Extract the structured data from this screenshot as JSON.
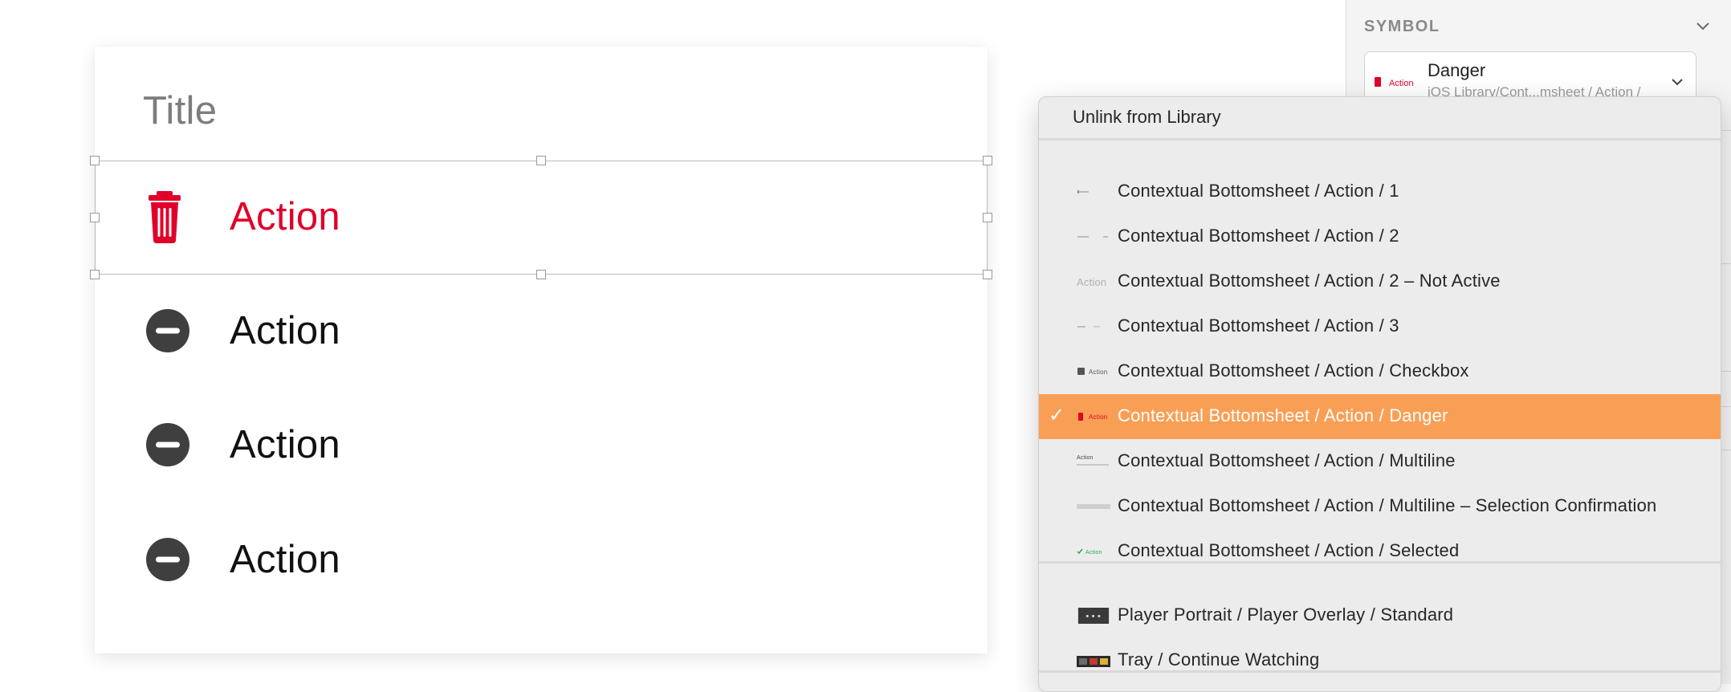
{
  "canvas": {
    "title": "Title",
    "rows": [
      {
        "label": "Action",
        "icon": "trash-icon",
        "variant": "danger"
      },
      {
        "label": "Action",
        "icon": "minus-circle-icon",
        "variant": "normal"
      },
      {
        "label": "Action",
        "icon": "minus-circle-icon",
        "variant": "normal"
      },
      {
        "label": "Action",
        "icon": "minus-circle-icon",
        "variant": "normal"
      }
    ]
  },
  "inspector": {
    "section_title": "SYMBOL",
    "symbol": {
      "name": "Danger",
      "path": "iOS Library/Cont...msheet / Action /",
      "thumb_label": "Action"
    }
  },
  "menu": {
    "unlink_label": "Unlink from Library",
    "group1": [
      {
        "label": "Contextual Bottomsheet / Action / 1",
        "thumb": "line"
      },
      {
        "label": "Contextual Bottomsheet / Action / 2",
        "thumb": "line"
      },
      {
        "label": "Contextual Bottomsheet / Action / 2 – Not Active",
        "thumb": "text",
        "thumb_text": "Action"
      },
      {
        "label": "Contextual Bottomsheet / Action / 3",
        "thumb": "line"
      },
      {
        "label": "Contextual Bottomsheet / Action / Checkbox",
        "thumb": "checkbox",
        "thumb_text": "Action"
      },
      {
        "label": "Contextual Bottomsheet / Action / Danger",
        "thumb": "danger",
        "thumb_text": "Action",
        "selected": true
      },
      {
        "label": "Contextual Bottomsheet / Action / Multiline",
        "thumb": "multiline",
        "thumb_text": "Action"
      },
      {
        "label": "Contextual Bottomsheet / Action / Multiline – Selection Confirmation",
        "thumb": "bar"
      },
      {
        "label": "Contextual Bottomsheet / Action / Selected",
        "thumb": "selected",
        "thumb_text": "Action"
      }
    ],
    "group2": [
      {
        "label": "Player Portrait / Player Overlay / Standard",
        "thumb": "player"
      },
      {
        "label": "Tray / Continue Watching",
        "thumb": "tray"
      }
    ],
    "selected_color": "#f99f55"
  },
  "colors": {
    "danger": "#e0002a",
    "icon_dark": "#3f3f3f",
    "accent": "#f99f55"
  }
}
